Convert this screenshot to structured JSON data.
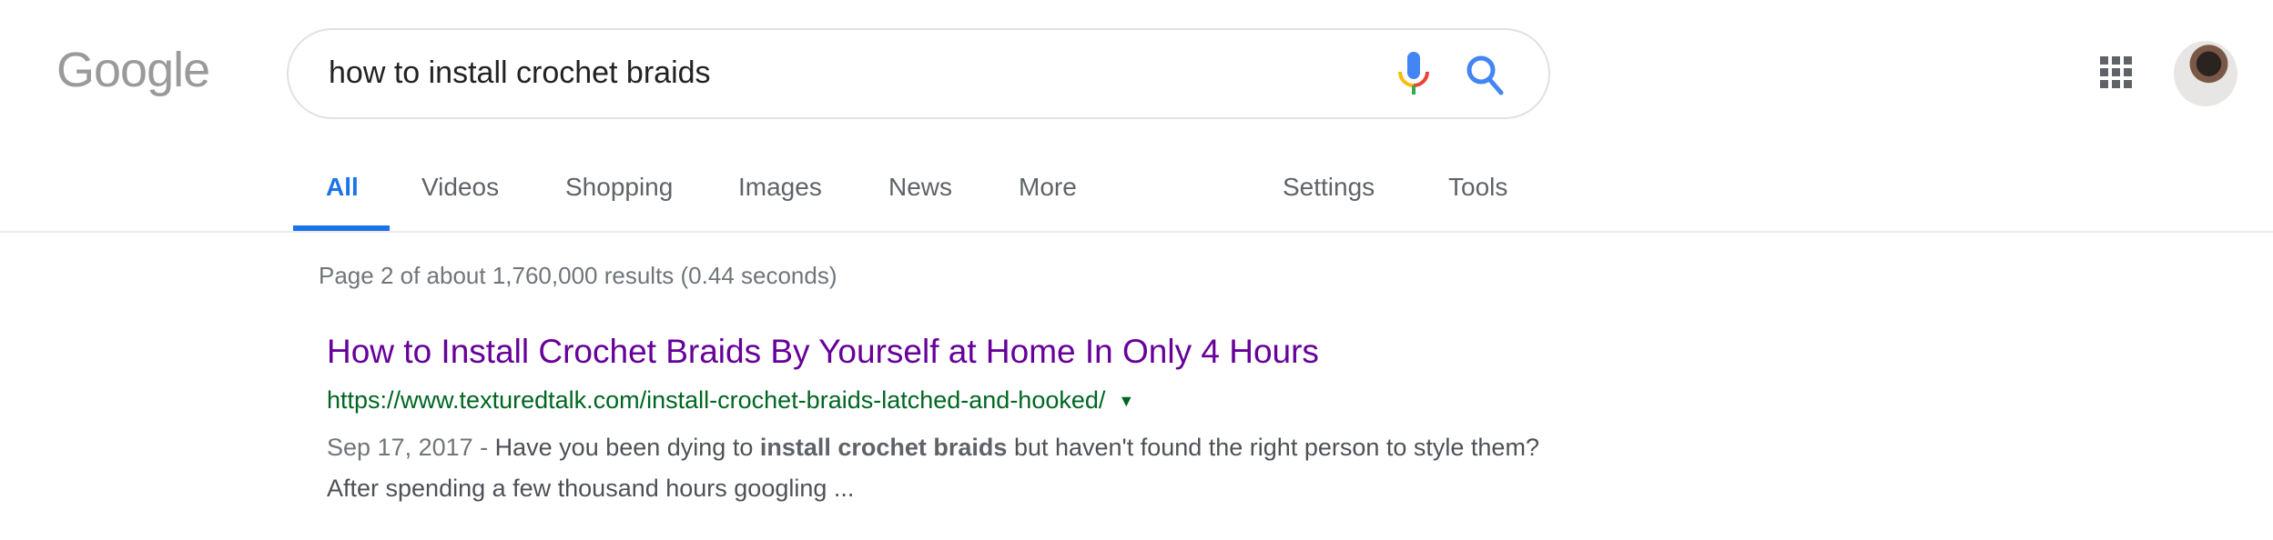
{
  "logo": {
    "text": "Google"
  },
  "search": {
    "query": "how to install crochet braids",
    "mic_icon": "microphone-icon",
    "search_icon": "search-icon"
  },
  "header": {
    "apps_icon": "apps-grid-icon",
    "avatar": "user-avatar"
  },
  "tabs": [
    {
      "label": "All",
      "active": true
    },
    {
      "label": "Videos"
    },
    {
      "label": "Shopping"
    },
    {
      "label": "Images"
    },
    {
      "label": "News"
    },
    {
      "label": "More"
    },
    {
      "label": "Settings"
    },
    {
      "label": "Tools"
    }
  ],
  "stats": "Page 2 of about 1,760,000 results (0.44 seconds)",
  "results": [
    {
      "title": "How to Install Crochet Braids By Yourself at Home In Only 4 Hours",
      "url": "https://www.texturedtalk.com/install-crochet-braids-latched-and-hooked/",
      "url_menu_icon": "▼",
      "date": "Sep 17, 2017 - ",
      "snippet_before": "Have you been dying to ",
      "snippet_bold": "install crochet braids",
      "snippet_after": " but haven't found the right person to style them? After spending a few thousand hours googling ..."
    }
  ],
  "colors": {
    "accent": "#1a73e8",
    "visited_link": "#660099",
    "url_green": "#006621"
  }
}
